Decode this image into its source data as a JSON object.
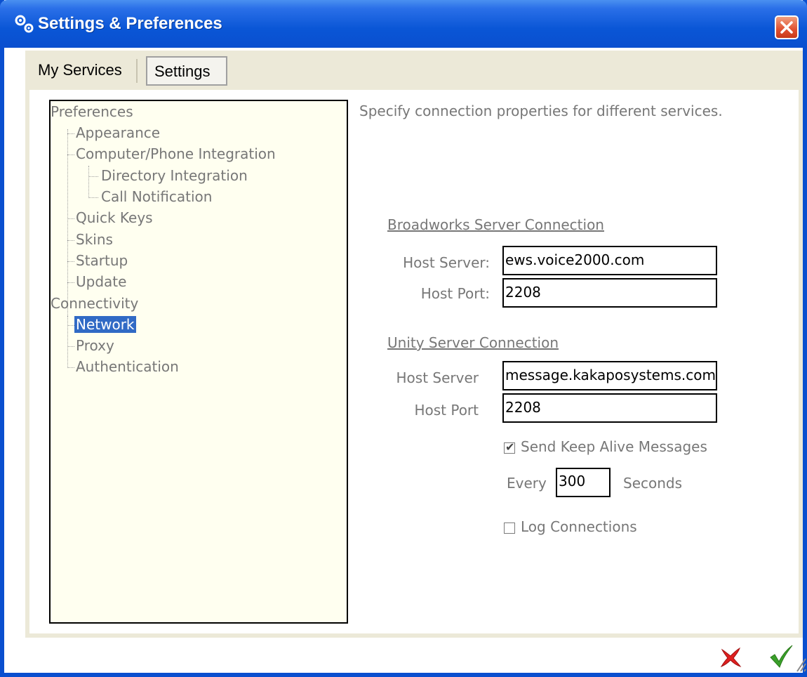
{
  "window": {
    "title": "Settings & Preferences"
  },
  "tabs": [
    {
      "label": "My Services"
    },
    {
      "label": "Settings"
    }
  ],
  "tree": {
    "preferences": "Preferences",
    "appearance": "Appearance",
    "computer_phone": "Computer/Phone Integration",
    "directory": "Directory Integration",
    "call_notification": "Call Notification",
    "quick_keys": "Quick Keys",
    "skins": "Skins",
    "startup": "Startup",
    "update": "Update",
    "connectivity": "Connectivity",
    "network": "Network",
    "proxy": "Proxy",
    "authentication": "Authentication",
    "selected": "Network"
  },
  "panel": {
    "description": "Specify connection properties for different services.",
    "broadworks": {
      "title": "Broadworks Server Connection",
      "host_server_label": "Host Server:",
      "host_server_value": "ews.voice2000.com",
      "host_port_label": "Host Port:",
      "host_port_value": "2208"
    },
    "unity": {
      "title": "Unity Server Connection",
      "host_server_label": "Host Server",
      "host_server_value": "message.kakaposystems.com",
      "host_port_label": "Host Port",
      "host_port_value": "2208",
      "keep_alive_label": "Send Keep Alive Messages",
      "keep_alive_checked": true,
      "every_label": "Every",
      "every_value": "300",
      "seconds_label": "Seconds",
      "log_label": "Log Connections",
      "log_checked": false
    }
  },
  "colors": {
    "titlebar": "#0a4fcf",
    "selection": "#316ac5",
    "tree_bg": "#fffff0",
    "cancel_icon": "#e02020",
    "ok_icon": "#3aa02a"
  },
  "icons": {
    "title": "gears-icon",
    "close": "close-icon",
    "cancel": "cancel-x-icon",
    "ok": "checkmark-icon"
  }
}
